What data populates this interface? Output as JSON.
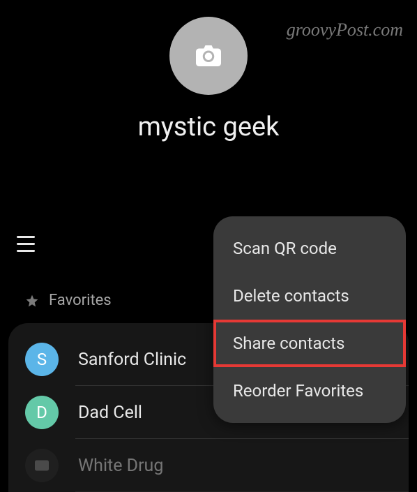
{
  "watermark": "groovyPost.com",
  "profile": {
    "name": "mystic geek"
  },
  "favorites": {
    "label": "Favorites"
  },
  "contacts": [
    {
      "initial": "S",
      "name": "Sanford Clinic",
      "color": "#5bb5e8"
    },
    {
      "initial": "D",
      "name": "Dad Cell",
      "color": "#64c9a8"
    },
    {
      "initial": "",
      "name": "White Drug",
      "color": "#2a2a2a"
    }
  ],
  "menu": {
    "items": [
      {
        "label": "Scan QR code"
      },
      {
        "label": "Delete contacts"
      },
      {
        "label": "Share contacts"
      },
      {
        "label": "Reorder Favorites"
      }
    ]
  }
}
